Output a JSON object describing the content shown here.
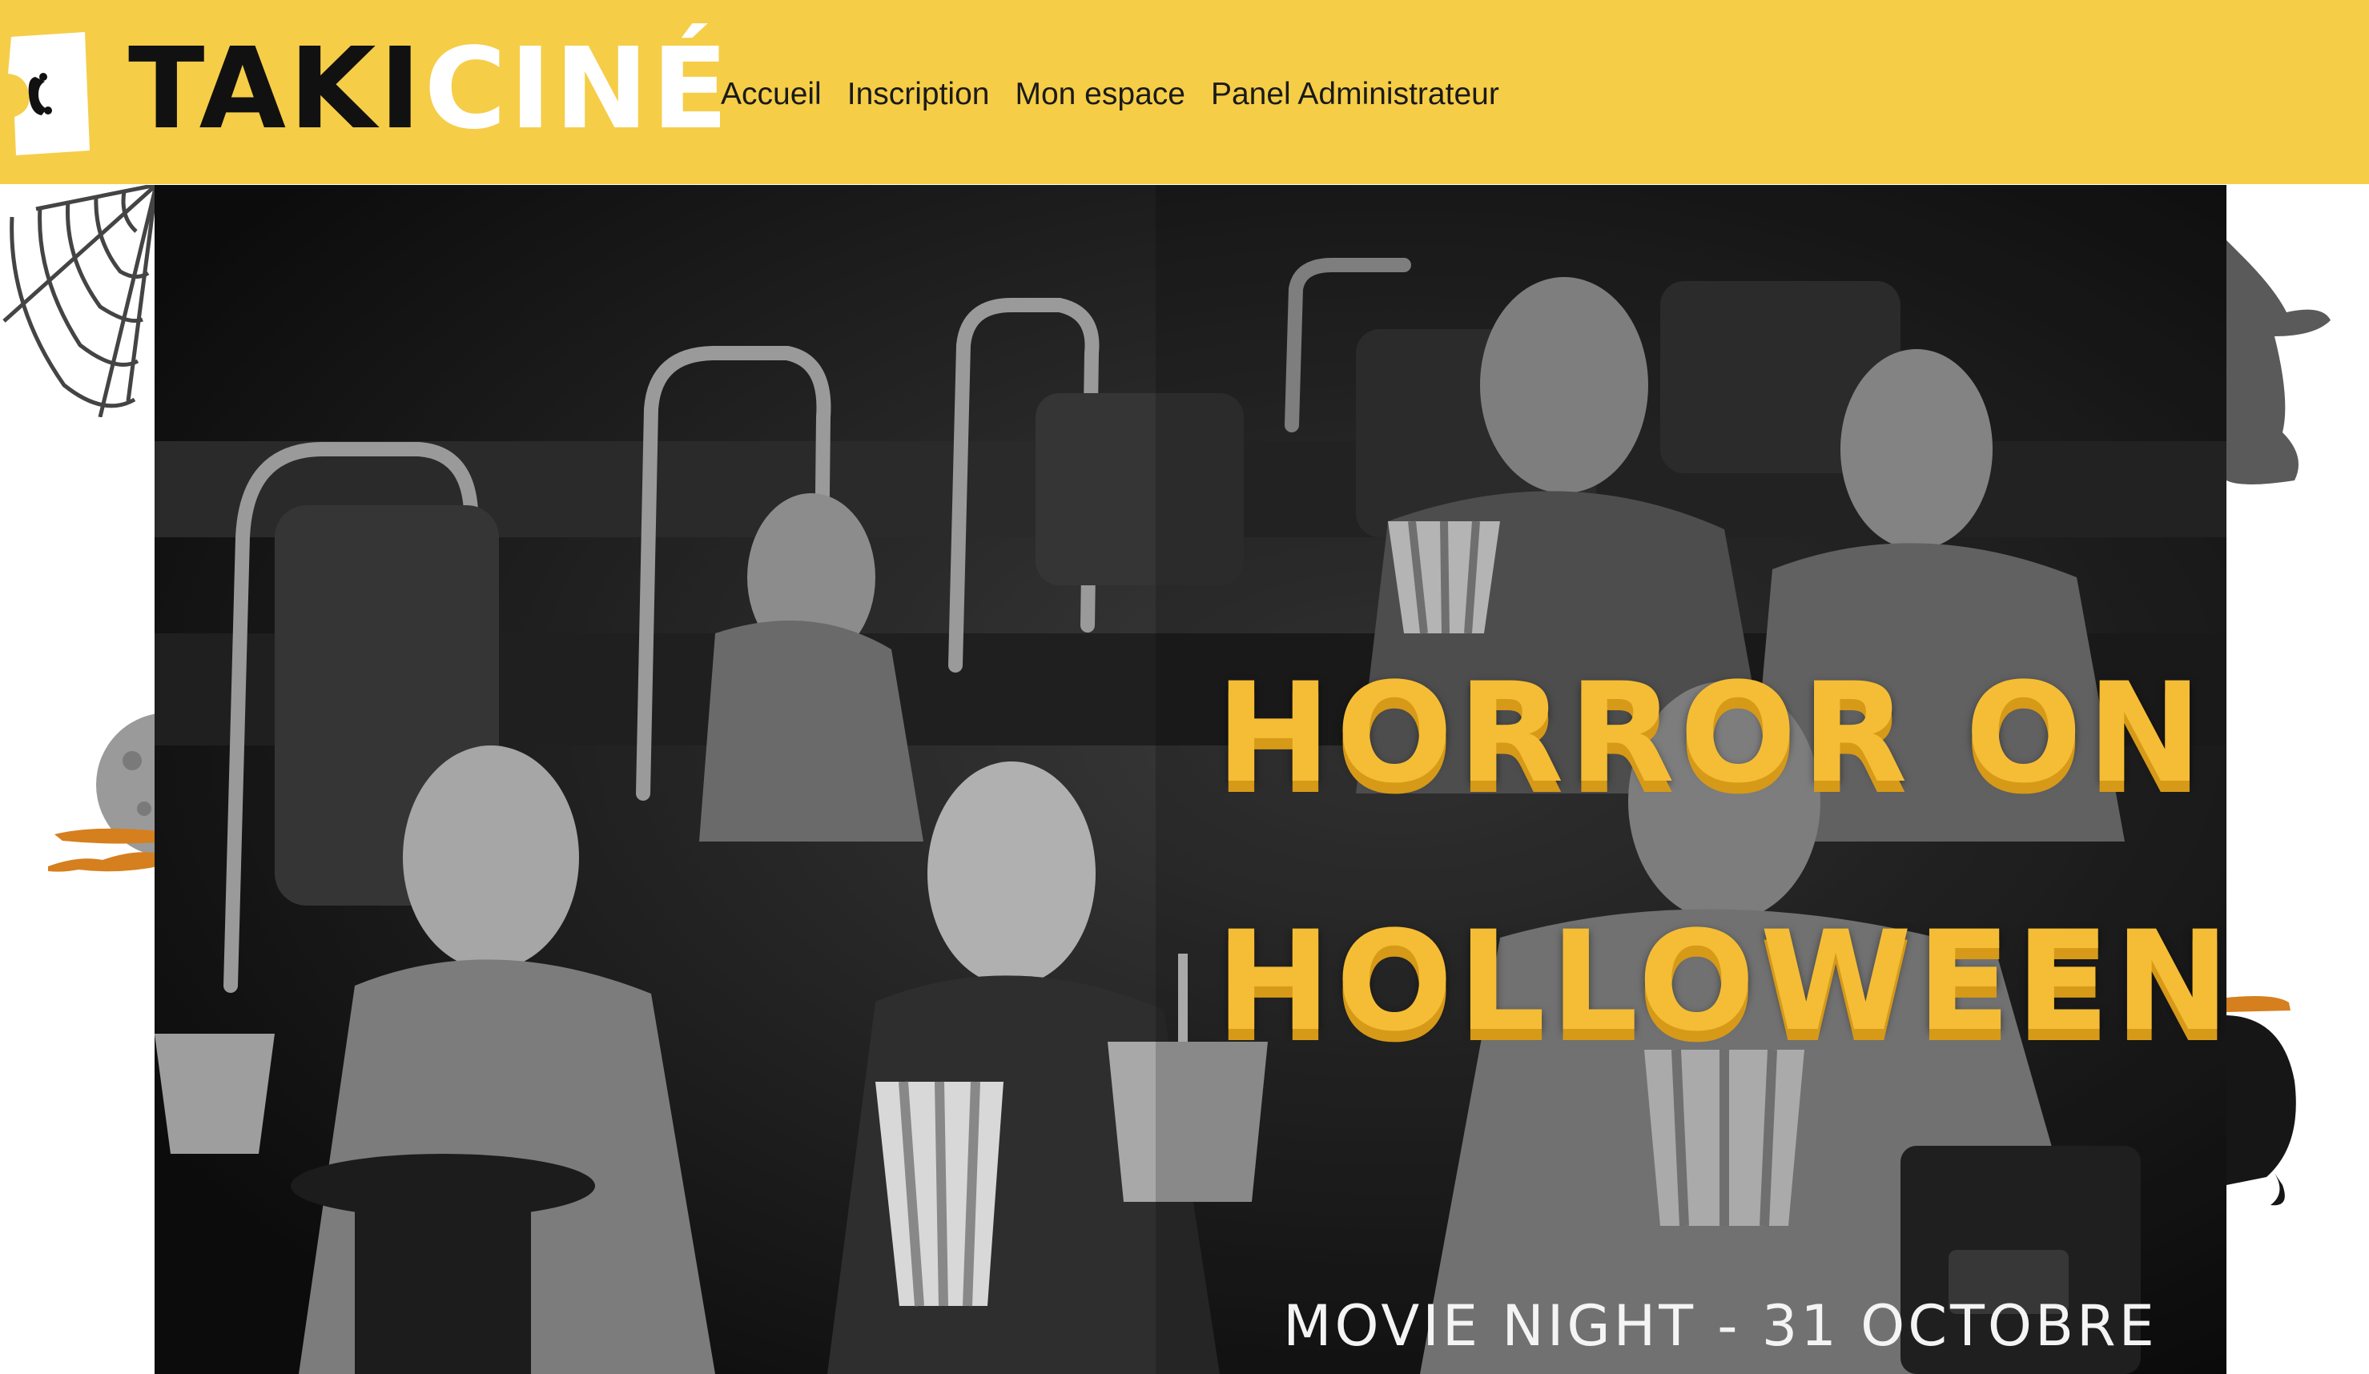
{
  "brand": {
    "logo_text_dark": "TAKI",
    "logo_text_light": "CINÉ",
    "ticket_icon": "ticket-icon",
    "color_yellow": "#f5cd47",
    "color_dark": "#111111"
  },
  "nav": {
    "items": [
      {
        "label": "Accueil"
      },
      {
        "label": "Inscription"
      },
      {
        "label": "Mon espace"
      },
      {
        "label": "Panel Administrateur"
      }
    ]
  },
  "hero": {
    "title_line1": "HORROR ON",
    "title_line2": "HOLLOWEEN",
    "subtitle": "MOVIE NIGHT - 31 OCTOBRE",
    "title_color": "#f5bd35",
    "image": "cinema-audience-photo"
  },
  "decorations": {
    "icons": [
      "spider-web-icon",
      "moon-icon",
      "witch-hat-icon",
      "cauldron-icon"
    ]
  }
}
